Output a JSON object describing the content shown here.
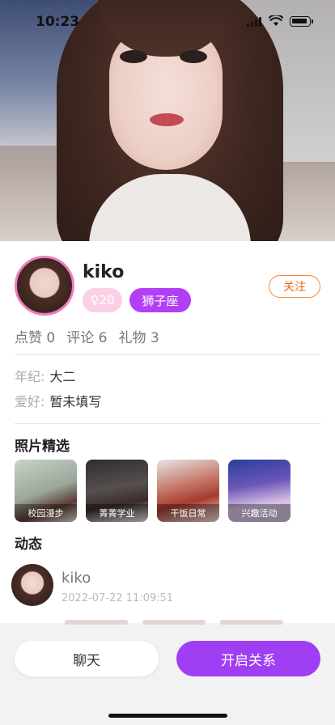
{
  "status_bar": {
    "time": "10:23"
  },
  "profile": {
    "name": "kiko",
    "age_badge": "♀20",
    "zodiac": "狮子座",
    "follow_label": "关注",
    "stats": [
      {
        "label": "点赞",
        "value": "0"
      },
      {
        "label": "评论",
        "value": "6"
      },
      {
        "label": "礼物",
        "value": "3"
      }
    ],
    "info": [
      {
        "key": "年纪:",
        "value": "大二"
      },
      {
        "key": "爱好:",
        "value": "暂未填写"
      }
    ]
  },
  "photos_section": {
    "title": "照片精选",
    "items": [
      {
        "caption": "校园漫步"
      },
      {
        "caption": "菁菁学业"
      },
      {
        "caption": "干饭日常"
      },
      {
        "caption": "兴趣活动"
      }
    ]
  },
  "feed_section": {
    "title": "动态",
    "post": {
      "author": "kiko",
      "time": "2022-07-22 11:09:51"
    }
  },
  "actions": {
    "chat_label": "聊天",
    "relation_label": "开启关系"
  },
  "colors": {
    "accent_purple": "#a03ef3",
    "avatar_ring": "#f07cc0",
    "follow_orange": "#f06a1a",
    "age_badge_pink": "#fbd0e6"
  }
}
